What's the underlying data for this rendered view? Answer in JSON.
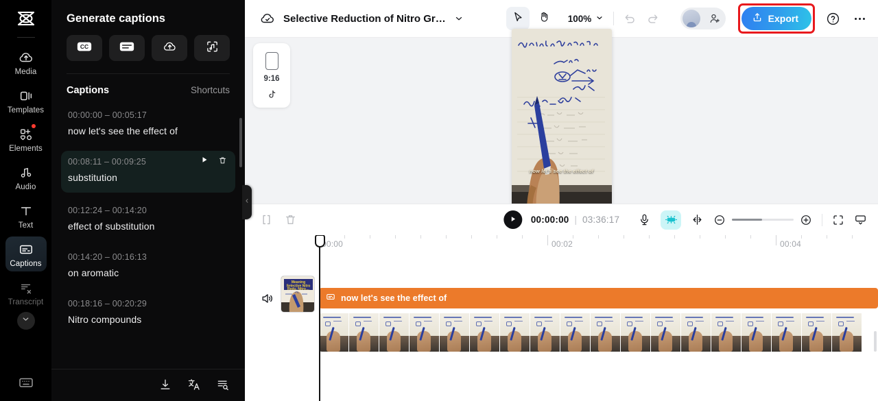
{
  "rail": {
    "logo_icon": "capcut-logo-icon",
    "items": [
      {
        "label": "Media",
        "icon": "cloud-upload-icon",
        "state": "normal"
      },
      {
        "label": "Templates",
        "icon": "templates-icon",
        "state": "normal"
      },
      {
        "label": "Elements",
        "icon": "elements-icon",
        "state": "normal",
        "badge": true
      },
      {
        "label": "Audio",
        "icon": "music-note-icon",
        "state": "normal"
      },
      {
        "label": "Text",
        "icon": "text-t-icon",
        "state": "normal"
      },
      {
        "label": "Captions",
        "icon": "captions-icon",
        "state": "active"
      },
      {
        "label": "Transcript",
        "icon": "transcript-icon",
        "state": "dim"
      }
    ],
    "expand_icon": "chevron-down-icon",
    "bottom_icon": "keyboard-icon"
  },
  "panel": {
    "title": "Generate captions",
    "generate_buttons": [
      {
        "icon": "cc-icon",
        "name": "auto-captions-button"
      },
      {
        "icon": "manual-caption-icon",
        "name": "manual-captions-button"
      },
      {
        "icon": "cloud-upload-icon",
        "name": "upload-captions-button"
      },
      {
        "icon": "audio-scan-icon",
        "name": "audio-to-text-button"
      }
    ],
    "captions_header": "Captions",
    "shortcuts_label": "Shortcuts",
    "items": [
      {
        "time": "00:00:00 – 00:05:17",
        "text": "now let's see the effect of",
        "selected": false
      },
      {
        "time": "00:08:11 – 00:09:25",
        "text": "substitution",
        "selected": true
      },
      {
        "time": "00:12:24 – 00:14:20",
        "text": "effect of substitution",
        "selected": false
      },
      {
        "time": "00:14:20 – 00:16:13",
        "text": "on aromatic",
        "selected": false
      },
      {
        "time": "00:18:16 – 00:20:29",
        "text": "Nitro compounds",
        "selected": false
      }
    ],
    "item_actions": {
      "play": "play-icon",
      "delete": "trash-icon"
    },
    "footer_icons": [
      {
        "icon": "download-icon",
        "name": "download-captions-button"
      },
      {
        "icon": "translate-icon",
        "name": "translate-captions-button"
      },
      {
        "icon": "batch-edit-icon",
        "name": "batch-edit-button"
      }
    ],
    "collapse_icon": "chevron-left-icon"
  },
  "topbar": {
    "cloud_icon": "cloud-check-icon",
    "project_title": "Selective Reduction of Nitro Gr…",
    "title_chevron": "chevron-down-icon",
    "tools": [
      {
        "icon": "cursor-select-icon",
        "name": "select-tool",
        "active": true
      },
      {
        "icon": "hand-pan-icon",
        "name": "hand-tool",
        "active": false
      }
    ],
    "zoom_level": "100%",
    "zoom_chevron": "chevron-down-icon",
    "undo_icon": "undo-icon",
    "redo_icon": "redo-icon",
    "avatar_icon": "avatar",
    "invite_icon": "add-user-icon",
    "export_label": "Export",
    "export_icon": "upload-share-icon",
    "help_icon": "help-circle-icon",
    "more_icon": "more-horizontal-icon",
    "highlight_color": "#e8191d",
    "export_gradient_from": "#2f7ff0",
    "export_gradient_to": "#2ec3e8"
  },
  "preview": {
    "ratio_card": {
      "ratio": "9:16",
      "platform_icon": "tiktok-icon",
      "frame_icon": "portrait-frame-icon"
    },
    "video_caption": "now let's see the effect of",
    "notebook_lines": [
      "Aliphatic nitro compounds",
      "NO2  LAH",
      "LiAlH4 / THF",
      "Sn/conc. HCl",
      "NH2"
    ]
  },
  "timeline_tools": {
    "split_icon": "split-clip-icon",
    "delete_icon": "trash-icon",
    "play_icon": "play-icon",
    "current_time": "00:00:00",
    "separator": "|",
    "total_time": "03:36:17",
    "mic_icon": "microphone-icon",
    "ai_icon": "ai-magic-icon",
    "ai_bg_color": "#ccf5f7",
    "mirror_icon": "mirror-split-icon",
    "zoom_out_icon": "zoom-out-icon",
    "zoom_in_icon": "zoom-in-icon",
    "zoom_slider_percent": 49,
    "fit_icon": "fit-to-screen-icon",
    "track_view_icon": "track-view-icon"
  },
  "timeline": {
    "ruler_labels": [
      "00:00",
      "00:02",
      "00:04"
    ],
    "playhead_position": "00:00",
    "speaker_icon": "speaker-icon",
    "caption_track": {
      "icon": "captions-icon",
      "label": "now let's see the effect of",
      "color": "#ec7a2a"
    },
    "video_frame_count": 18
  }
}
